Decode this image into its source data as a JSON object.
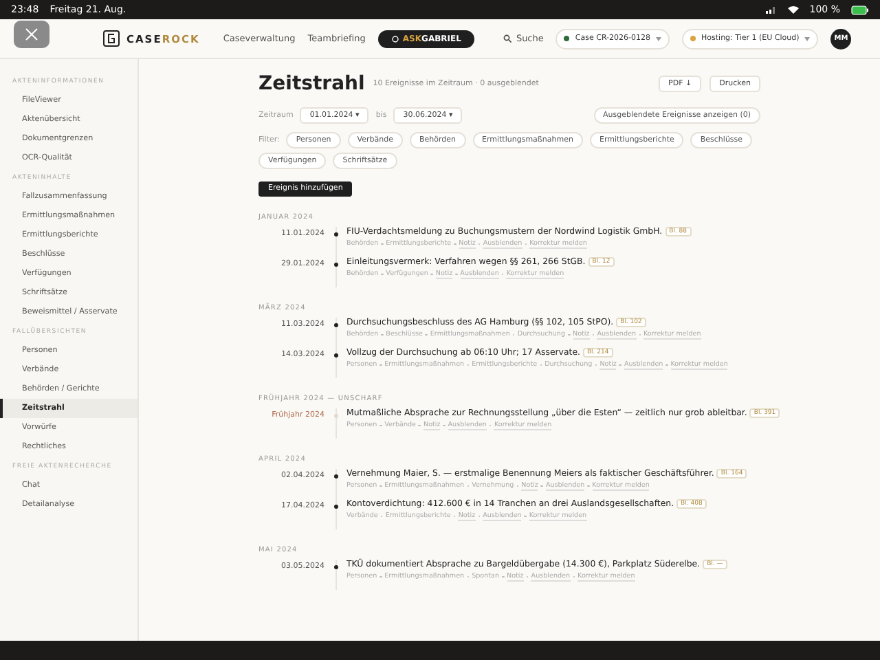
{
  "status_bar": {
    "time": "23:48",
    "date": "Freitag 21. Aug.",
    "battery": "100 %"
  },
  "header": {
    "brand_primary": "CASE",
    "brand_accent": "ROCK",
    "nav": [
      "Caseverwaltung",
      "Teambriefing"
    ],
    "assistant": {
      "prefix": "ASK",
      "name": "GABRIEL"
    },
    "search": "Suche",
    "selectors": [
      {
        "label": "Case CR-2026-0128",
        "color": "#2f6b3a"
      },
      {
        "label": "Hosting: Tier 1 (EU Cloud)",
        "color": "#d9a441"
      }
    ],
    "avatar": "MM"
  },
  "sidebar": [
    {
      "heading": "AKTENINFORMATIONEN",
      "items": [
        {
          "label": "FileViewer",
          "selected": false
        },
        {
          "label": "Aktenübersicht",
          "selected": false
        },
        {
          "label": "Dokumentgrenzen",
          "selected": false
        },
        {
          "label": "OCR-Qualität",
          "selected": false
        }
      ]
    },
    {
      "heading": "AKTENINHALTE",
      "items": [
        {
          "label": "Fallzusammenfassung",
          "selected": false
        },
        {
          "label": "Ermittlungsmaßnahmen",
          "selected": false
        },
        {
          "label": "Ermittlungsberichte",
          "selected": false
        },
        {
          "label": "Beschlüsse",
          "selected": false
        },
        {
          "label": "Verfügungen",
          "selected": false
        },
        {
          "label": "Schriftsätze",
          "selected": false
        },
        {
          "label": "Beweismittel / Asservate",
          "selected": false
        }
      ]
    },
    {
      "heading": "FALLÜBERSICHTEN",
      "items": [
        {
          "label": "Personen",
          "selected": false
        },
        {
          "label": "Verbände",
          "selected": false
        },
        {
          "label": "Behörden / Gerichte",
          "selected": false
        },
        {
          "label": "Zeitstrahl",
          "selected": true
        },
        {
          "label": "Vorwürfe",
          "selected": false
        },
        {
          "label": "Rechtliches",
          "selected": false
        }
      ]
    },
    {
      "heading": "FREIE AKTENRECHERCHE",
      "items": [
        {
          "label": "Chat",
          "selected": false
        },
        {
          "label": "Detailanalyse",
          "selected": false
        }
      ]
    }
  ],
  "page": {
    "title": "Zeitstrahl",
    "summary": "10 Ereignisse im Zeitraum · 0 ausgeblendet",
    "actions": [
      "PDF ↓",
      "Drucken"
    ],
    "range_label": "Zeitraum",
    "range_from": "01.01.2024 ▾",
    "range_sep": "bis",
    "range_to": "30.06.2024 ▾",
    "show_hidden": "Ausgeblendete Ereignisse anzeigen (0)",
    "filter_label": "Filter:",
    "filters": [
      {
        "label": "Personen",
        "selected": false
      },
      {
        "label": "Verbände",
        "selected": false
      },
      {
        "label": "Behörden",
        "selected": false
      },
      {
        "label": "Ermittlungsmaßnahmen",
        "selected": false
      },
      {
        "label": "Ermittlungsberichte",
        "selected": false
      },
      {
        "label": "Beschlüsse",
        "selected": false
      },
      {
        "label": "Verfügungen",
        "selected": false
      },
      {
        "label": "Schriftsätze",
        "selected": false
      }
    ],
    "add_button": "Ereignis hinzufügen"
  },
  "groups": [
    {
      "label": "JANUAR 2024",
      "events": [
        {
          "kind": "exact",
          "date": "11.01.2024",
          "text": "FIU-Verdachtsmeldung zu Buchungsmustern der Nordwind Logistik GmbH.",
          "ref": "Bl. 88",
          "tags": [
            "Behörden",
            "Ermittlungsberichte"
          ],
          "links": [
            "Notiz",
            "Ausblenden",
            "Korrektur melden"
          ]
        },
        {
          "kind": "exact",
          "date": "29.01.2024",
          "text": "Einleitungsvermerk: Verfahren wegen §§ 261, 266 StGB.",
          "ref": "Bl. 12",
          "tags": [
            "Behörden",
            "Verfügungen"
          ],
          "links": [
            "Notiz",
            "Ausblenden",
            "Korrektur melden"
          ]
        }
      ]
    },
    {
      "label": "MÄRZ 2024",
      "events": [
        {
          "kind": "exact",
          "date": "11.03.2024",
          "text": "Durchsuchungsbeschluss des AG Hamburg (§§ 102, 105 StPO).",
          "ref": "Bl. 102",
          "tags": [
            "Behörden",
            "Beschlüsse",
            "Ermittlungsmaßnahmen",
            "Durchsuchung"
          ],
          "links": [
            "Notiz",
            "Ausblenden",
            "Korrektur melden"
          ]
        },
        {
          "kind": "exact",
          "date": "14.03.2024",
          "text": "Vollzug der Durchsuchung ab 06:10 Uhr; 17 Asservate.",
          "ref": "Bl. 214",
          "tags": [
            "Personen",
            "Ermittlungsmaßnahmen",
            "Ermittlungsberichte",
            "Durchsuchung"
          ],
          "links": [
            "Notiz",
            "Ausblenden",
            "Korrektur melden"
          ]
        }
      ]
    },
    {
      "label": "FRÜHJAHR 2024 — UNSCHARF",
      "events": [
        {
          "kind": "fuzzy",
          "date": "Frühjahr 2024",
          "text": "Mutmaßliche Absprache zur Rechnungsstellung „über die Esten“ — zeitlich nur grob ableitbar.",
          "ref": "Bl. 391",
          "tags": [
            "Personen",
            "Verbände"
          ],
          "links": [
            "Notiz",
            "Ausblenden",
            "Korrektur melden"
          ]
        }
      ]
    },
    {
      "label": "APRIL 2024",
      "events": [
        {
          "kind": "exact",
          "date": "02.04.2024",
          "text": "Vernehmung Maier, S. — erstmalige Benennung Meiers als faktischer Geschäftsführer.",
          "ref": "Bl. 164",
          "tags": [
            "Personen",
            "Ermittlungsmaßnahmen",
            "Vernehmung"
          ],
          "links": [
            "Notiz",
            "Ausblenden",
            "Korrektur melden"
          ]
        },
        {
          "kind": "exact",
          "date": "17.04.2024",
          "text": "Kontoverdichtung: 412.600 € in 14 Tranchen an drei Auslandsgesellschaften.",
          "ref": "Bl. 408",
          "tags": [
            "Verbände",
            "Ermittlungsberichte"
          ],
          "links": [
            "Notiz",
            "Ausblenden",
            "Korrektur melden"
          ]
        }
      ]
    },
    {
      "label": "MAI 2024",
      "events": [
        {
          "kind": "exact",
          "date": "03.05.2024",
          "text": "TKÜ dokumentiert Absprache zu Bargeldübergabe (14.300 €), Parkplatz Süderelbe.",
          "ref": "Bl. —",
          "tags": [
            "Personen",
            "Ermittlungsmaßnahmen",
            "Spontan"
          ],
          "links": [
            "Notiz",
            "Ausblenden",
            "Korrektur melden"
          ]
        }
      ]
    }
  ]
}
